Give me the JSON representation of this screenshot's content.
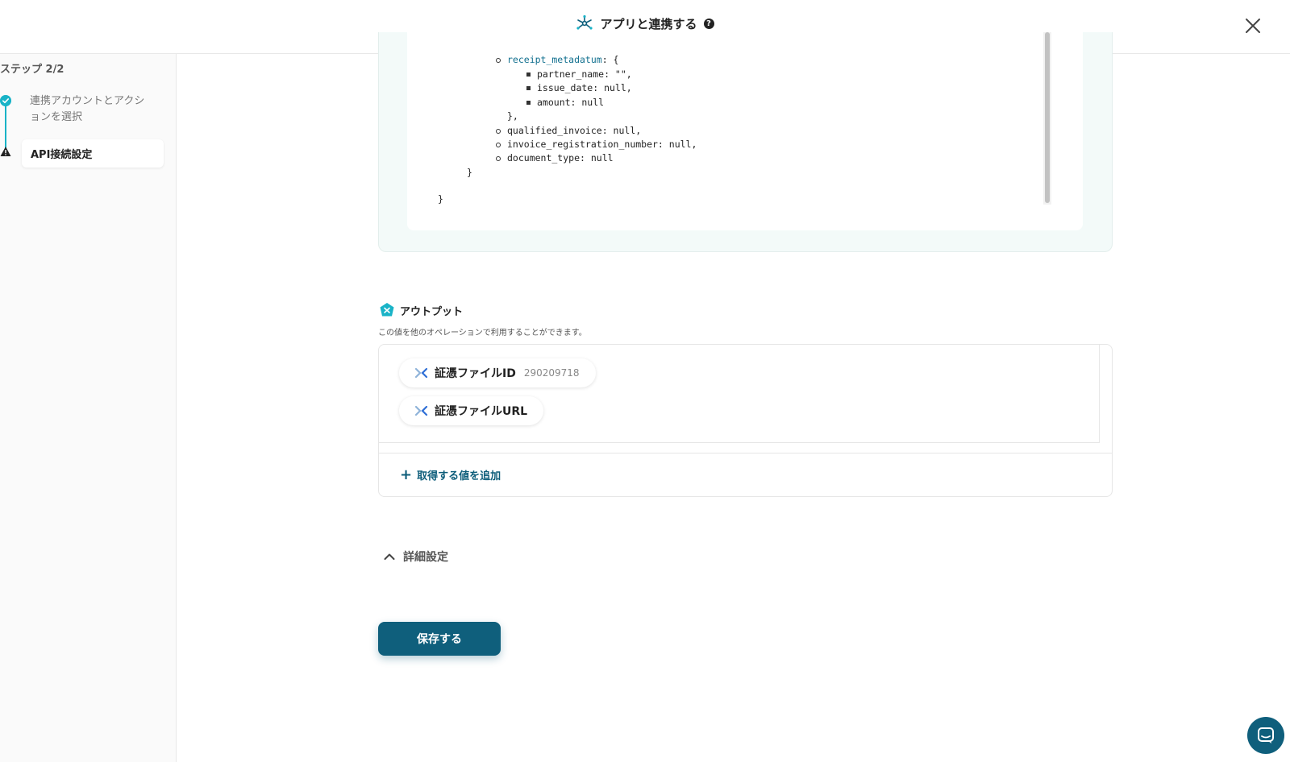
{
  "header": {
    "title": "アプリと連携する",
    "help": "?"
  },
  "sidebar": {
    "step_label": "ステップ 2/2",
    "steps": [
      {
        "label": "連携アカウントとアクションを選択",
        "status": "done"
      },
      {
        "label": "API接続設定",
        "status": "warning"
      }
    ]
  },
  "code": {
    "lines": [
      {
        "key": "receipt_metadatum",
        "rest": ": {"
      },
      {
        "text": "partner_name: \"\","
      },
      {
        "text": "issue_date: null,"
      },
      {
        "text": "amount: null"
      },
      {
        "text": "},"
      },
      {
        "text": "qualified_invoice: null,"
      },
      {
        "text": "invoice_registration_number: null,"
      },
      {
        "text": "document_type: null"
      },
      {
        "text": "}"
      },
      {
        "text": "}"
      }
    ]
  },
  "output": {
    "title": "アウトプット",
    "description": "この値を他のオペレーションで利用することができます。",
    "items": [
      {
        "name": "証憑ファイルID",
        "value": "290209718"
      },
      {
        "name": "証憑ファイルURL",
        "value": ""
      }
    ],
    "add_label": "取得する値を追加"
  },
  "advanced": {
    "label": "詳細設定"
  },
  "save": {
    "label": "保存する"
  },
  "colors": {
    "primary": "#0f5f7c",
    "accent": "#19b3c7"
  }
}
